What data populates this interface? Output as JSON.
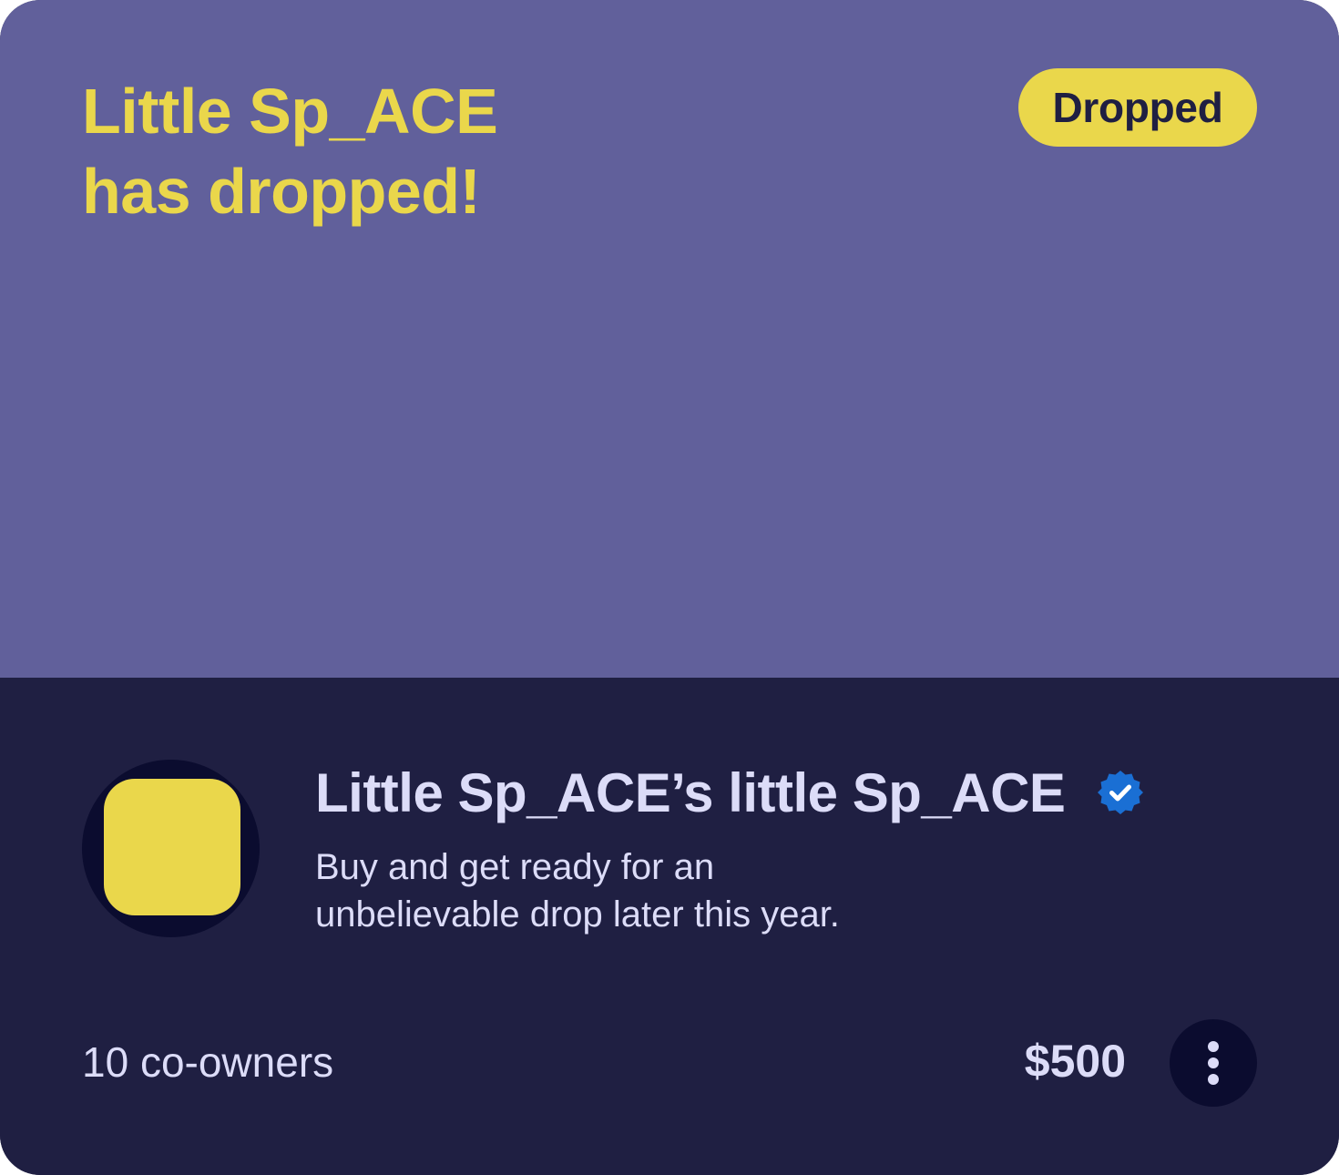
{
  "hero": {
    "title_line1": "Little Sp_ACE",
    "title_line2": "has dropped!",
    "status_badge": "Dropped"
  },
  "collection": {
    "name": "Little Sp_ACE’s little Sp_ACE",
    "verified_icon": "verified-badge-icon",
    "description_line1": "Buy and get ready for an",
    "description_line2": "unbelievable drop later this year."
  },
  "footer": {
    "owners": "10 co-owners",
    "price": "$500",
    "more_icon": "more-vertical-icon"
  },
  "colors": {
    "hero_background": "#61609b",
    "card_background": "#1f1f42",
    "accent_yellow": "#ead74b",
    "text_light": "#dcdcf8",
    "verified_blue": "#1a6fd4",
    "dark_circle": "#0b0c2f"
  }
}
